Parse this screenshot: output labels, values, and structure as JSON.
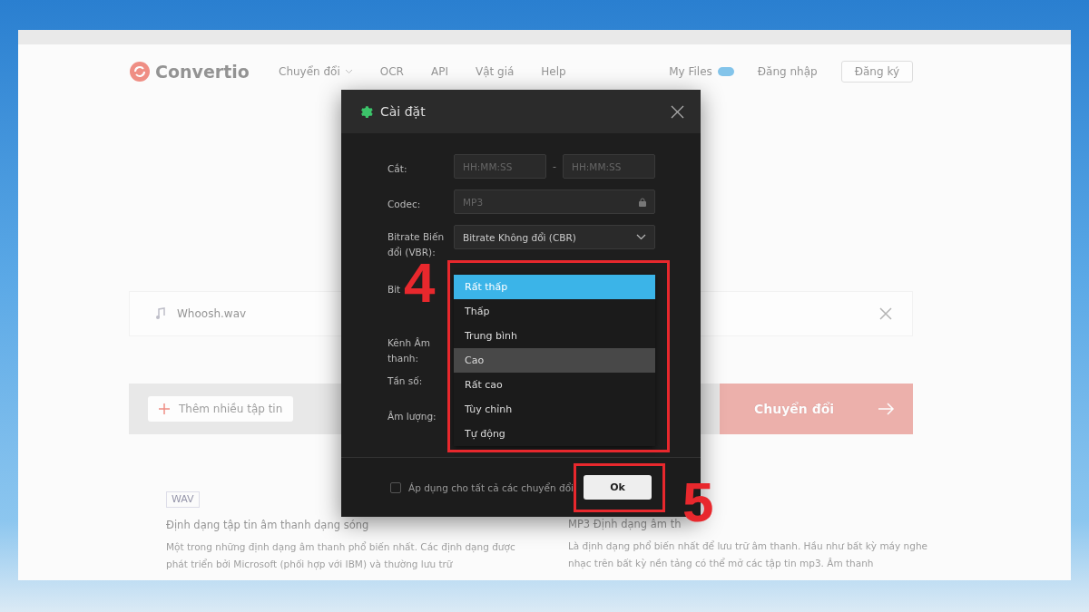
{
  "site_header": {
    "logo": "Convertio",
    "nav": [
      {
        "label": "Chuyển đổi",
        "kind": "dropdown"
      },
      {
        "label": "OCR",
        "kind": "link"
      },
      {
        "label": "API",
        "kind": "link"
      },
      {
        "label": "Vật giá",
        "kind": "link"
      },
      {
        "label": "Help",
        "kind": "link"
      }
    ],
    "my_files": "My Files",
    "login": "Đăng nhập",
    "signup": "Đăng ký"
  },
  "file_row": {
    "file_name": "Whoosh.wav"
  },
  "action_bar": {
    "add_files": "Thêm nhiều tập tin",
    "convert": "Chuyển đổi"
  },
  "formats": [
    {
      "badge": "WAV",
      "title": "Định dạng tập tin âm thanh dạng sóng",
      "description": "Một trong những định dạng âm thanh phổ biến nhất. Các định dạng được phát triển bởi Microsoft (phối hợp với IBM) và thường lưu trữ"
    },
    {
      "title": "MP3 Định dạng âm th",
      "description": "Là định dạng phổ biến nhất để lưu trữ âm thanh. Hầu như bất kỳ máy nghe nhạc trên bất kỳ nền tảng có thể mở các tập tin mp3. Âm thanh"
    }
  ],
  "dialog": {
    "title": "Cài đặt",
    "fields": [
      {
        "label": "Cắt:",
        "kind": "range",
        "placeholders": [
          "HH:MM:SS",
          "HH:MM:SS"
        ],
        "separator": "-"
      },
      {
        "label": "Codec:",
        "kind": "locked",
        "value": "MP3"
      },
      {
        "label": "Bitrate Biến đổi (VBR):",
        "kind": "select",
        "value": "Bitrate Không đổi (CBR)"
      },
      {
        "label": "Bit",
        "kind": "open-select"
      },
      {
        "label": "Kênh Âm thanh:",
        "kind": "hidden"
      },
      {
        "label": "Tần số:",
        "kind": "hidden"
      },
      {
        "label": "Âm lượng:",
        "kind": "hidden"
      }
    ],
    "options": [
      {
        "label": "Rất thấp",
        "selected": true,
        "highlighted": false
      },
      {
        "label": "Thấp",
        "selected": false,
        "highlighted": false
      },
      {
        "label": "Trung bình",
        "selected": false,
        "highlighted": false
      },
      {
        "label": "Cao",
        "selected": false,
        "highlighted": true
      },
      {
        "label": "Rất cao",
        "selected": false,
        "highlighted": false
      },
      {
        "label": "Tùy chỉnh",
        "selected": false,
        "highlighted": false
      },
      {
        "label": "Tự động",
        "selected": false,
        "highlighted": false
      }
    ],
    "apply_all": {
      "label": "Áp dụng cho tất cả các chuyển đổi",
      "checked": false
    },
    "ok": "Ok"
  },
  "annotations": [
    {
      "label": "4"
    },
    {
      "label": "5"
    }
  ]
}
